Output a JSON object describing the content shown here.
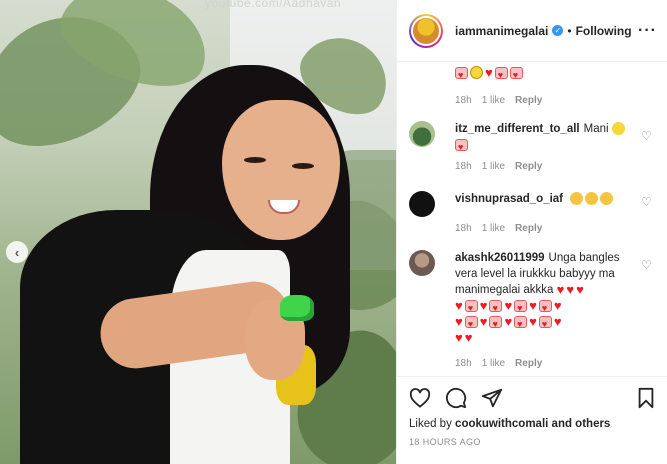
{
  "photo": {
    "watermark": "youtube.com/Aadhavan"
  },
  "header": {
    "username": "iammanimegalai",
    "follow_state": "Following",
    "separator": "•"
  },
  "comments": [
    {
      "id": "c0",
      "username": "",
      "text": "",
      "emoji": [
        "face-heart",
        "scream",
        "heart",
        "face-heart",
        "face-heart"
      ],
      "time": "18h",
      "likes": "1 like",
      "reply": "Reply"
    },
    {
      "id": "c1",
      "username": "itz_me_different_to_all",
      "text": "Mani",
      "emoji": [
        "grin",
        "face-heart"
      ],
      "time": "18h",
      "likes": "1 like",
      "reply": "Reply"
    },
    {
      "id": "c2",
      "username": "vishnuprasad_o_iaf",
      "text": "",
      "emoji": [
        "clap",
        "clap",
        "clap"
      ],
      "time": "18h",
      "likes": "1 like",
      "reply": "Reply"
    },
    {
      "id": "c3",
      "username": "akashk26011999",
      "text": "Unga bangles vera level la irukkku babyyy ma manimegalai akkka",
      "emoji_rows": 3,
      "time": "18h",
      "likes": "1 like",
      "reply": "Reply"
    }
  ],
  "actions": {
    "liked_by_prefix": "Liked by",
    "liked_by_user": "cookuwithcomali",
    "liked_by_suffix": "and others",
    "time_ago": "18 HOURS AGO"
  },
  "colors": {
    "verified": "#3897f0",
    "heart": "#ed1c24",
    "muted_text": "#8e8e8e"
  }
}
